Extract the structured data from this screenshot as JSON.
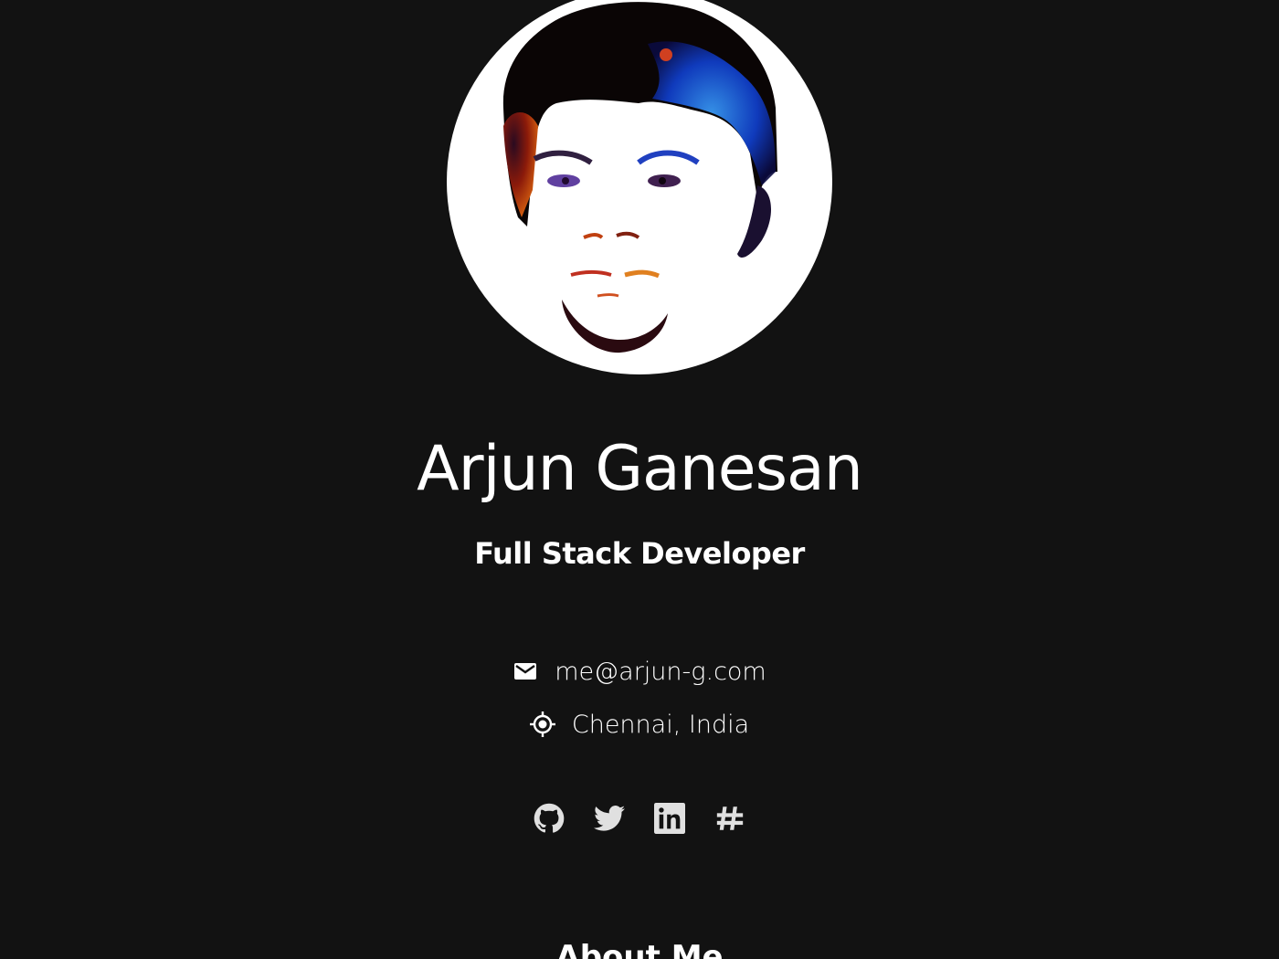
{
  "profile": {
    "avatar_alt": "Arjun Ganesan",
    "name": "Arjun Ganesan",
    "role": "Full Stack Developer"
  },
  "contact": {
    "email": "me@arjun-g.com",
    "email_icon": "mail-icon",
    "location": "Chennai, India",
    "location_icon": "location-target-icon"
  },
  "socials": [
    {
      "name": "GitHub",
      "icon": "github-icon"
    },
    {
      "name": "Twitter",
      "icon": "twitter-icon"
    },
    {
      "name": "LinkedIn",
      "icon": "linkedin-icon"
    },
    {
      "name": "Hashnode",
      "icon": "hashnode-icon"
    }
  ],
  "sections": {
    "about_heading": "About Me"
  },
  "colors": {
    "background": "#121212",
    "text": "#ffffff",
    "icon": "#e0e0e0"
  }
}
